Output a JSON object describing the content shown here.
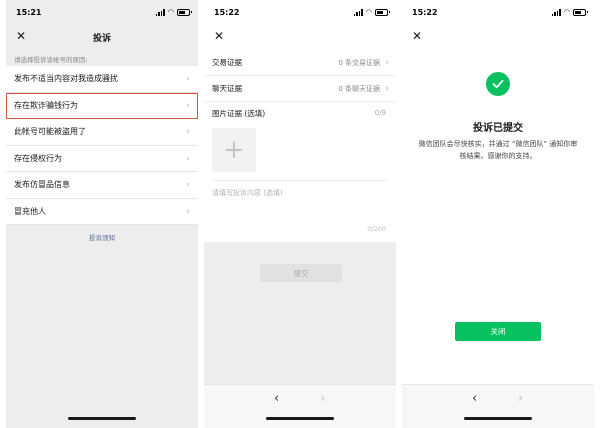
{
  "screen1": {
    "time": "15:21",
    "title": "投诉",
    "hint": "请选择投诉该帐号的原因:",
    "reasons": [
      "发布不适当内容对我造成骚扰",
      "存在欺诈骗钱行为",
      "此帐号可能被盗用了",
      "存在侵权行为",
      "发布仿冒品信息",
      "冒充他人"
    ],
    "selected_index": 1,
    "notice_link": "投诉须知"
  },
  "screen2": {
    "time": "15:22",
    "transaction_label": "交易证据",
    "transaction_value": "0 条交易证据",
    "chat_label": "聊天证据",
    "chat_value": "0 条聊天证据",
    "image_label": "图片证据 (选填)",
    "image_count": "0/9",
    "text_placeholder": "请填写投诉内容 (选填)",
    "text_count": "0/200",
    "submit_label": "提交"
  },
  "screen3": {
    "time": "15:22",
    "title": "投诉已提交",
    "message": "微信团队会尽快核实，并通过 “微信团队” 通知你审核结果。感谢你的支持。",
    "close_label": "关闭"
  },
  "colors": {
    "accent_green": "#07c160",
    "selected_outline": "#d0573c",
    "link_blue": "#576b95"
  }
}
